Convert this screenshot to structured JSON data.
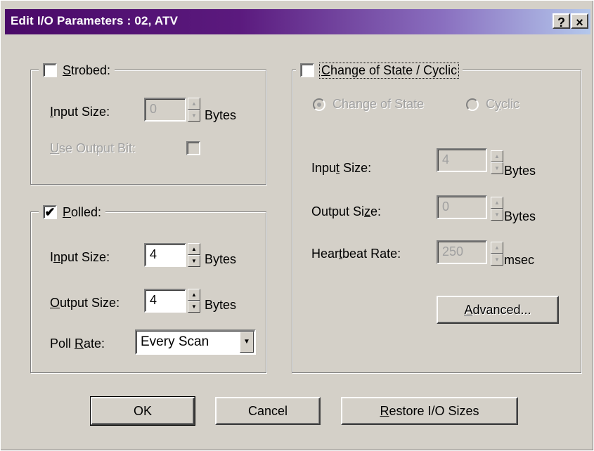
{
  "window": {
    "title": "Edit I/O Parameters : 02, ATV",
    "help_button": "?",
    "close_button": "×"
  },
  "strobed": {
    "label": "Strobed:",
    "checked": false,
    "input_size_label": "Input Size:",
    "input_size_value": "0",
    "input_size_unit": "Bytes",
    "use_output_bit_label": "Use Output Bit:",
    "use_output_bit_checked": false
  },
  "polled": {
    "label": "Polled:",
    "checked": true,
    "check_mark": "✔",
    "input_size_label": "Input Size:",
    "input_size_value": "4",
    "input_size_unit": "Bytes",
    "output_size_label": "Output Size:",
    "output_size_value": "4",
    "output_size_unit": "Bytes",
    "poll_rate_label": "Poll Rate:",
    "poll_rate_value": "Every Scan"
  },
  "cos": {
    "label": "Change of State / Cyclic",
    "checked": false,
    "option_cos_label": "Change of State",
    "option_cyclic_label": "Cyclic",
    "selected_option": "Change of State",
    "input_size_label": "Input Size:",
    "input_size_value": "4",
    "input_size_unit": "Bytes",
    "output_size_label": "Output Size:",
    "output_size_value": "0",
    "output_size_unit": "Bytes",
    "heartbeat_label": "Heartbeat Rate:",
    "heartbeat_value": "250",
    "heartbeat_unit": "msec",
    "advanced_label": "Advanced..."
  },
  "buttons": {
    "ok": "OK",
    "cancel": "Cancel",
    "restore": "Restore I/O Sizes"
  },
  "icons": {
    "spin_up": "▲",
    "spin_down": "▼",
    "dropdown": "▼"
  },
  "colors": {
    "face": "#d4d0c8",
    "title_start": "#4a0a68",
    "title_end": "#b4c8ec",
    "disabled_text": "#a0a0a0"
  }
}
